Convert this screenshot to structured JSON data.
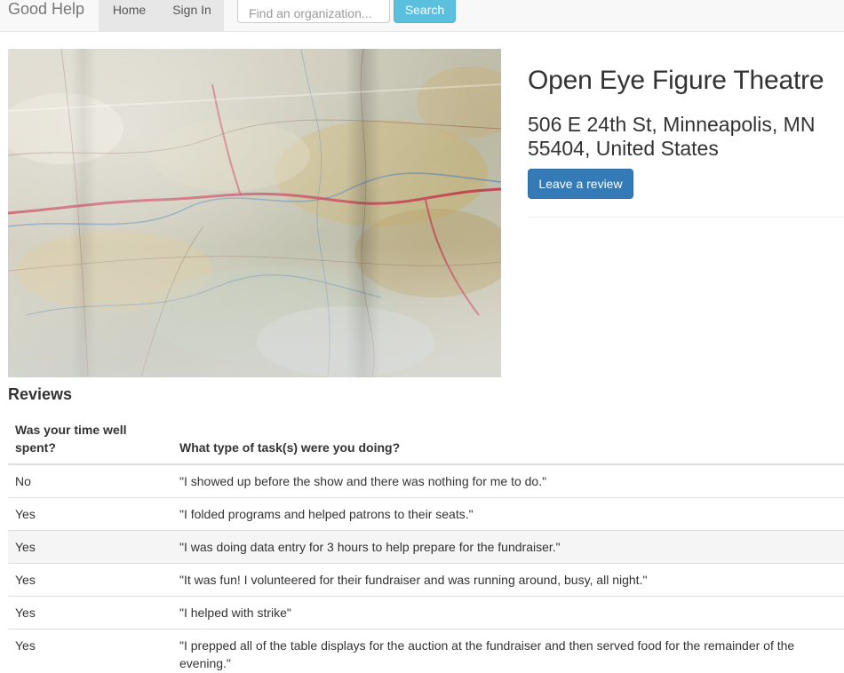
{
  "navbar": {
    "brand": "Good Help",
    "items": [
      {
        "label": "Home"
      },
      {
        "label": "Sign In"
      }
    ],
    "search": {
      "placeholder": "Find an organization...",
      "button_label": "Search"
    }
  },
  "organization": {
    "name": "Open Eye Figure Theatre",
    "address": "506 E 24th St, Minneapolis, MN 55404, United States",
    "review_button_label": "Leave a review"
  },
  "reviews": {
    "title": "Reviews",
    "columns": [
      "Was your time well spent?",
      "What type of task(s) were you doing?"
    ],
    "rows": [
      {
        "time_well_spent": "No",
        "task": "\"I showed up before the show and there was nothing for me to do.\""
      },
      {
        "time_well_spent": "Yes",
        "task": "\"I folded programs and helped patrons to their seats.\""
      },
      {
        "time_well_spent": "Yes",
        "task": "\"I was doing data entry for 3 hours to help prepare for the fundraiser.\""
      },
      {
        "time_well_spent": "Yes",
        "task": "\"It was fun! I volunteered for their fundraiser and was running around, busy, all night.\""
      },
      {
        "time_well_spent": "Yes",
        "task": "\"I helped with strike\""
      },
      {
        "time_well_spent": "Yes",
        "task": "\"I prepped all of the table displays for the auction at the fundraiser and then served food for the remainder of the evening.\""
      }
    ]
  },
  "colors": {
    "primary": "#337ab7",
    "info": "#5bc0de",
    "navbar_bg": "#f8f8f8",
    "text": "#333333"
  },
  "icons": {
    "hero_image": "map-photo"
  }
}
